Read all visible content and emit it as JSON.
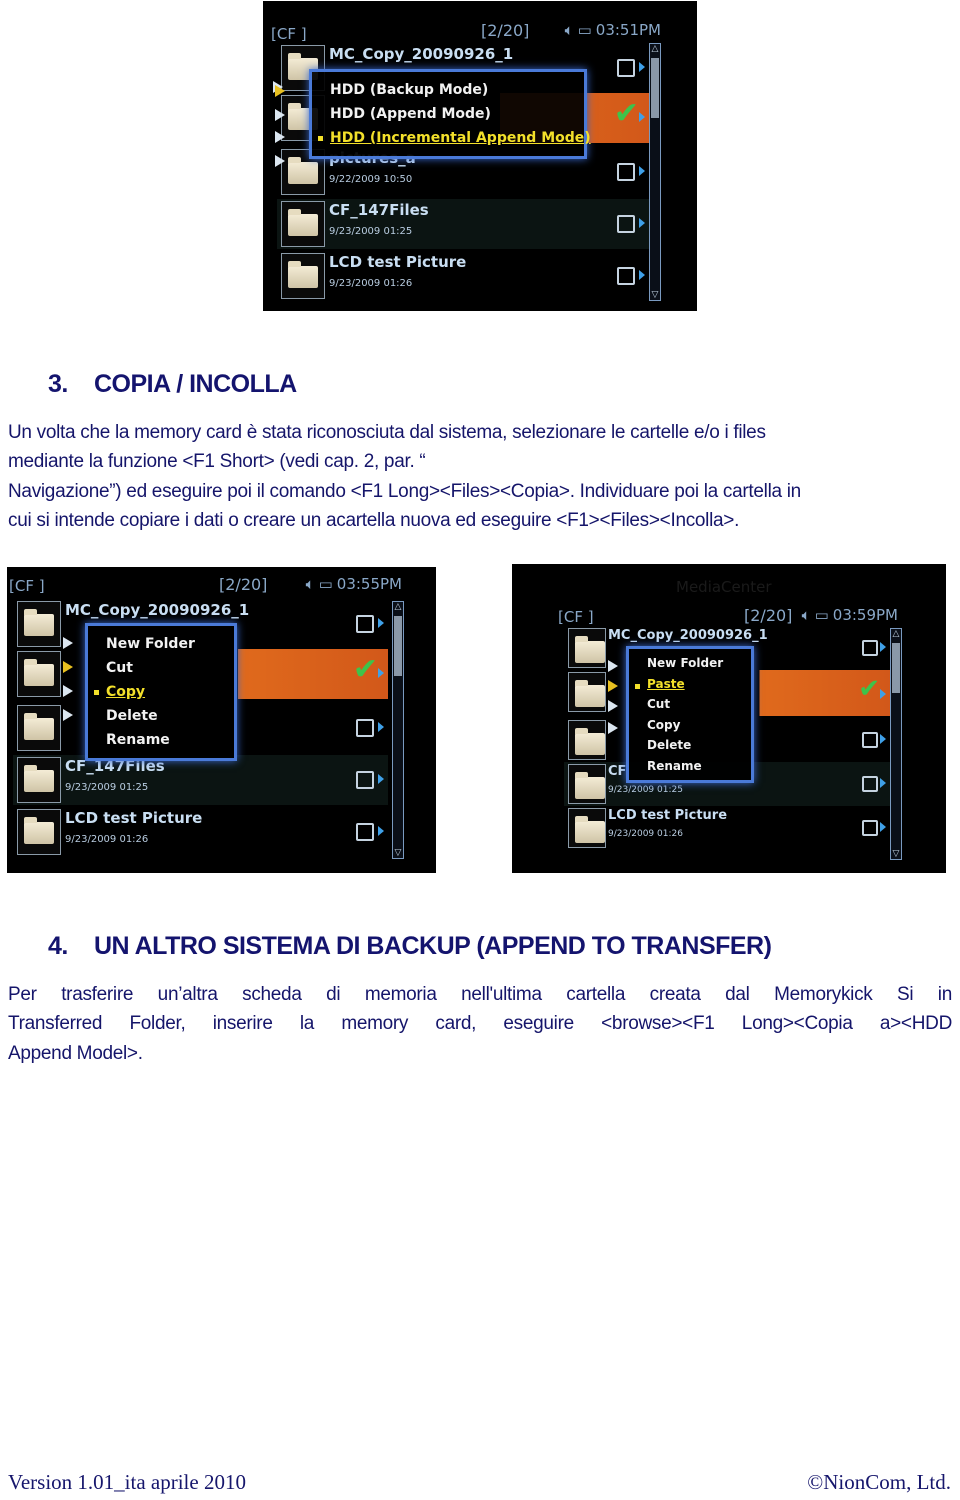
{
  "screenshots": [
    {
      "status": {
        "card": "[CF ]",
        "page": "[2/20]",
        "speaker_icon": "speaker-icon",
        "battery_icon": "battery-icon",
        "time": "03:51PM"
      },
      "rows": [
        {
          "name": "MC_Copy_20090926_1",
          "date": "",
          "checked": false
        },
        {
          "name": "",
          "date": "",
          "checked": true
        },
        {
          "name": "pictures_a",
          "date": "9/22/2009 10:50",
          "checked": false
        },
        {
          "name": "CF_147Files",
          "date": "9/23/2009 01:25",
          "checked": false
        },
        {
          "name": "LCD test Picture",
          "date": "9/23/2009 01:26",
          "checked": false
        }
      ],
      "menu": {
        "items": [
          "HDD (Backup Mode)",
          "HDD (Append Mode)",
          "HDD (Incremental Append Mode)"
        ],
        "active": "HDD (Incremental Append Mode)"
      }
    },
    {
      "status": {
        "card": "[CF ]",
        "page": "[2/20]",
        "speaker_icon": "speaker-icon",
        "battery_icon": "battery-icon",
        "time": "03:55PM"
      },
      "rows": [
        {
          "name": "MC_Copy_20090926_1",
          "date": "",
          "checked": false
        },
        {
          "name": "",
          "date": "",
          "checked": true
        },
        {
          "name": "",
          "date": "",
          "checked": false
        },
        {
          "name": "CF_147Files",
          "date": "9/23/2009 01:25",
          "checked": false
        },
        {
          "name": "LCD test Picture",
          "date": "9/23/2009 01:26",
          "checked": false
        }
      ],
      "menu": {
        "items": [
          "New Folder",
          "Cut",
          "Copy",
          "Delete",
          "Rename"
        ],
        "active": "Copy"
      }
    },
    {
      "status": {
        "card": "[CF ]",
        "page": "[2/20]",
        "speaker_icon": "speaker-icon",
        "battery_icon": "battery-icon",
        "time": "03:59PM"
      },
      "brand": "MediaCenter",
      "rows": [
        {
          "name": "MC_Copy_20090926_1",
          "date": "",
          "checked": false
        },
        {
          "name": "",
          "date": "",
          "checked": true
        },
        {
          "name": "",
          "date": "",
          "checked": false
        },
        {
          "name": "CF",
          "date": "9/23/2009 01:25",
          "checked": false
        },
        {
          "name": "LCD test Picture",
          "date": "9/23/2009 01:26",
          "checked": false
        }
      ],
      "menu": {
        "items": [
          "New Folder",
          "Paste",
          "Cut",
          "Copy",
          "Delete",
          "Rename"
        ],
        "active": "Paste"
      }
    }
  ],
  "section3": {
    "number": "3.",
    "title": "COPIA / INCOLLA",
    "lines": [
      "Un volta che la memory card è stata riconosciuta dal sistema, selezionare le cartelle e/o i files",
      "mediante la funzione <F1 Short> (vedi cap. 2, par. “",
      "Navigazione”) ed eseguire poi il comando <F1 Long><Files><Copia>. Individuare poi la cartella in",
      "cui si intende copiare i dati o creare un acartella nuova ed eseguire <F1><Files><Incolla>."
    ]
  },
  "section4": {
    "number": "4.",
    "title": "UN ALTRO SISTEMA DI BACKUP (APPEND TO TRANSFER)",
    "lines": [
      "Per trasferire un’altra scheda di memoria nell'ultima cartella creata dal Memorykick Si in",
      "Transferred Folder, inserire la memory card, eseguire <browse><F1 Long><Copia a><HDD",
      "Append Model>."
    ]
  },
  "footer": {
    "left": "Version 1.01_ita aprile 2010",
    "right": "©NionCom, Ltd."
  }
}
